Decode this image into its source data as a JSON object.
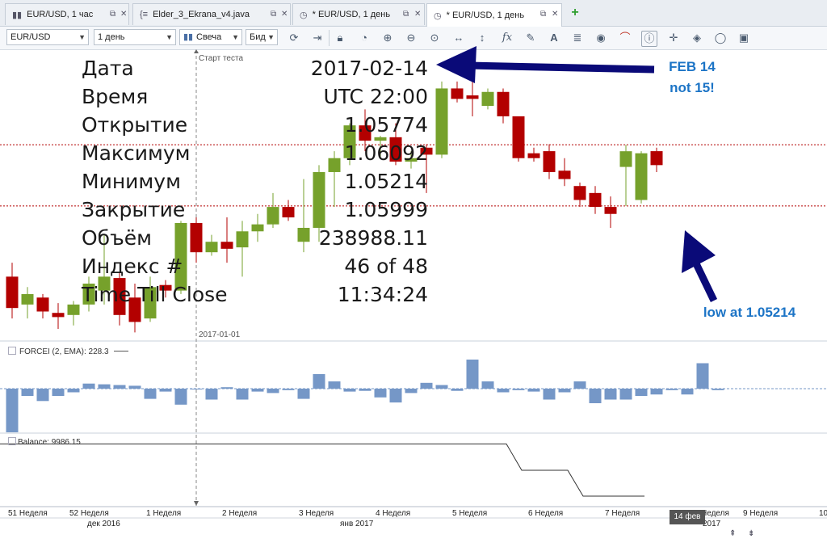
{
  "tabs": [
    {
      "label": "EUR/USD, 1 час",
      "icon": "chart-bars-icon",
      "active": false
    },
    {
      "label": "Elder_3_Ekrana_v4.java",
      "icon": "code-braces-icon",
      "active": false
    },
    {
      "label": "* EUR/USD, 1 день",
      "icon": "clock-icon",
      "active": false
    },
    {
      "label": "* EUR/USD, 1 день",
      "icon": "clock-icon",
      "active": true
    }
  ],
  "toolbar": {
    "instrument": "EUR/USD",
    "period": "1 день",
    "chart_type": "Свеча",
    "offer_side": "Бид",
    "icons": [
      "refresh-icon",
      "arrow-right-bar-icon",
      "lock-icon",
      "zoom-clock-icon",
      "zoom-in-icon",
      "zoom-out-icon",
      "zoom-fit-icon",
      "horizontal-arrows-icon",
      "vertical-arrows-icon",
      "fx-icon",
      "pencil-icon",
      "text-tool-icon",
      "layers-icon",
      "eye-icon",
      "chart-style-icon",
      "info-icon",
      "crosshair-icon",
      "fill-icon",
      "circle-icon",
      "save-icon"
    ]
  },
  "overlay": {
    "rows": [
      {
        "label": "Дата",
        "value": "2017-02-14"
      },
      {
        "label": "Время",
        "value": "UTC 22:00"
      },
      {
        "label": "Открытие",
        "value": "1.05774"
      },
      {
        "label": "Максимум",
        "value": "1.06092"
      },
      {
        "label": "Минимум",
        "value": "1.05214"
      },
      {
        "label": "Закрытие",
        "value": "1.05999"
      },
      {
        "label": "Объём",
        "value": "238988.11"
      },
      {
        "label": "Индекс #",
        "value": "46 of 48"
      },
      {
        "label": "Time Till Close",
        "value": "11:34:24"
      }
    ]
  },
  "annotations": {
    "feb_line1": "FEB 14",
    "feb_line2": "not 15!",
    "low": "low at 1.05214"
  },
  "chart_labels": {
    "start_test": "Старт теста",
    "date_marker": "2017-01-01",
    "force_label": "FORCEI (2, EMA): 228.3",
    "balance_label": "Balance: 9986.15",
    "cursor_date": "14 фев"
  },
  "time_axis": {
    "weeks": [
      "51 Неделя",
      "52 Неделя",
      "1 Неделя",
      "2 Неделя",
      "3 Неделя",
      "4 Неделя",
      "5 Неделя",
      "6 Неделя",
      "7 Неделя",
      "Неделя",
      "9 Неделя",
      "10"
    ],
    "months": [
      "дек 2016",
      "янв 2017",
      "2017"
    ]
  },
  "colors": {
    "bull": "#76a12b",
    "bear": "#b30000",
    "force": "#7597c7",
    "arrow": "#0a0a78",
    "note": "#1c74c6"
  },
  "chart_data": {
    "type": "candlestick",
    "candles": [
      {
        "o": 1.042,
        "h": 1.044,
        "l": 1.036,
        "c": 1.0375
      },
      {
        "o": 1.038,
        "h": 1.0405,
        "l": 1.036,
        "c": 1.0395
      },
      {
        "o": 1.039,
        "h": 1.0395,
        "l": 1.036,
        "c": 1.037
      },
      {
        "o": 1.0368,
        "h": 1.0382,
        "l": 1.0345,
        "c": 1.0362
      },
      {
        "o": 1.0365,
        "h": 1.0385,
        "l": 1.035,
        "c": 1.038
      },
      {
        "o": 1.038,
        "h": 1.042,
        "l": 1.037,
        "c": 1.041
      },
      {
        "o": 1.04,
        "h": 1.048,
        "l": 1.038,
        "c": 1.042
      },
      {
        "o": 1.0418,
        "h": 1.0425,
        "l": 1.035,
        "c": 1.0365
      },
      {
        "o": 1.039,
        "h": 1.041,
        "l": 1.034,
        "c": 1.0355
      },
      {
        "o": 1.036,
        "h": 1.042,
        "l": 1.0355,
        "c": 1.0405
      },
      {
        "o": 1.0408,
        "h": 1.0415,
        "l": 1.039,
        "c": 1.04
      },
      {
        "o": 1.04,
        "h": 1.05,
        "l": 1.0395,
        "c": 1.0497
      },
      {
        "o": 1.0497,
        "h": 1.0505,
        "l": 1.044,
        "c": 1.0455
      },
      {
        "o": 1.0455,
        "h": 1.048,
        "l": 1.045,
        "c": 1.047
      },
      {
        "o": 1.047,
        "h": 1.0505,
        "l": 1.044,
        "c": 1.046
      },
      {
        "o": 1.0462,
        "h": 1.05,
        "l": 1.042,
        "c": 1.0485
      },
      {
        "o": 1.0485,
        "h": 1.051,
        "l": 1.047,
        "c": 1.0495
      },
      {
        "o": 1.0495,
        "h": 1.054,
        "l": 1.049,
        "c": 1.052
      },
      {
        "o": 1.052,
        "h": 1.053,
        "l": 1.05,
        "c": 1.0505
      },
      {
        "o": 1.047,
        "h": 1.056,
        "l": 1.0455,
        "c": 1.049
      },
      {
        "o": 1.049,
        "h": 1.058,
        "l": 1.047,
        "c": 1.057
      },
      {
        "o": 1.057,
        "h": 1.06,
        "l": 1.052,
        "c": 1.059
      },
      {
        "o": 1.059,
        "h": 1.064,
        "l": 1.058,
        "c": 1.0637
      },
      {
        "o": 1.0637,
        "h": 1.066,
        "l": 1.06,
        "c": 1.0615
      },
      {
        "o": 1.0615,
        "h": 1.0622,
        "l": 1.059,
        "c": 1.062
      },
      {
        "o": 1.062,
        "h": 1.064,
        "l": 1.058,
        "c": 1.0585
      },
      {
        "o": 1.0585,
        "h": 1.06,
        "l": 1.0575,
        "c": 1.059
      },
      {
        "o": 1.0605,
        "h": 1.061,
        "l": 1.054,
        "c": 1.0595
      },
      {
        "o": 1.0595,
        "h": 1.07,
        "l": 1.059,
        "c": 1.069
      },
      {
        "o": 1.069,
        "h": 1.07,
        "l": 1.067,
        "c": 1.0675
      },
      {
        "o": 1.068,
        "h": 1.072,
        "l": 1.065,
        "c": 1.0675
      },
      {
        "o": 1.0665,
        "h": 1.069,
        "l": 1.066,
        "c": 1.0685
      },
      {
        "o": 1.0685,
        "h": 1.069,
        "l": 1.064,
        "c": 1.065
      },
      {
        "o": 1.065,
        "h": 1.065,
        "l": 1.0585,
        "c": 1.059
      },
      {
        "o": 1.0597,
        "h": 1.0605,
        "l": 1.0585,
        "c": 1.059
      },
      {
        "o": 1.06,
        "h": 1.061,
        "l": 1.056,
        "c": 1.057
      },
      {
        "o": 1.0572,
        "h": 1.059,
        "l": 1.055,
        "c": 1.056
      },
      {
        "o": 1.055,
        "h": 1.0555,
        "l": 1.052,
        "c": 1.053
      },
      {
        "o": 1.054,
        "h": 1.055,
        "l": 1.051,
        "c": 1.052
      },
      {
        "o": 1.052,
        "h": 1.0535,
        "l": 1.049,
        "c": 1.051
      },
      {
        "o": 1.05774,
        "h": 1.06092,
        "l": 1.05214,
        "c": 1.05999
      },
      {
        "o": 1.053,
        "h": 1.06,
        "l": 1.0525,
        "c": 1.0597
      },
      {
        "o": 1.06,
        "h": 1.0605,
        "l": 1.057,
        "c": 1.058
      }
    ],
    "force": [
      -60,
      -10,
      -17,
      -10,
      -5,
      7,
      6,
      5,
      4,
      -14,
      -4,
      -22,
      0,
      -15,
      2,
      -15,
      -4,
      -6,
      -2,
      -14,
      20,
      10,
      -4,
      -3,
      -12,
      -19,
      -6,
      8,
      5,
      -3,
      40,
      10,
      -5,
      -2,
      -4,
      -15,
      -5,
      10,
      -20,
      -15,
      -15,
      -10,
      -8,
      -2,
      -8,
      35,
      -2
    ],
    "balance": [
      10000,
      10000,
      10000,
      10000,
      10000,
      10000,
      10000,
      10000,
      10000,
      10000,
      10000,
      10000,
      10000,
      10000,
      10000,
      10000,
      10000,
      10000,
      10000,
      10000,
      10000,
      10000,
      10000,
      10000,
      10000,
      10000,
      10000,
      10000,
      10000,
      10000,
      10000,
      10000,
      10000,
      10000,
      9993,
      9993,
      9993,
      9993,
      9986.15,
      9986.15,
      9986.15,
      9986.15,
      9986.15
    ],
    "price_lines": [
      1.06092,
      1.05214
    ]
  }
}
